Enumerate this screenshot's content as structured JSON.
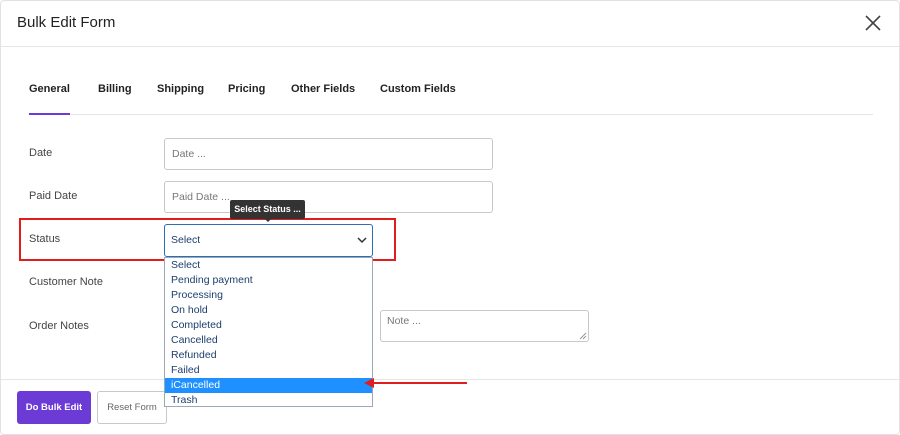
{
  "modal": {
    "title": "Bulk Edit Form"
  },
  "tabs": [
    {
      "label": "General"
    },
    {
      "label": "Billing"
    },
    {
      "label": "Shipping"
    },
    {
      "label": "Pricing"
    },
    {
      "label": "Other Fields"
    },
    {
      "label": "Custom Fields"
    }
  ],
  "form": {
    "date": {
      "label": "Date",
      "placeholder": "Date ..."
    },
    "paid_date": {
      "label": "Paid Date",
      "placeholder": "Paid Date ..."
    },
    "status": {
      "label": "Status",
      "tooltip": "Select Status ...",
      "value": "Select",
      "options": [
        "Select",
        "Pending payment",
        "Processing",
        "On hold",
        "Completed",
        "Cancelled",
        "Refunded",
        "Failed",
        "iCancelled",
        "Trash"
      ],
      "highlighted_option": "iCancelled"
    },
    "customer_note": {
      "label": "Customer Note"
    },
    "order_notes": {
      "label": "Order Notes",
      "placeholder": "Note ..."
    }
  },
  "footer": {
    "primary_label": "Do Bulk Edit",
    "secondary_label": "Reset Form"
  },
  "colors": {
    "accent": "#6c3bd5",
    "highlight_outline": "#e01e1e",
    "selected_option": "#1e90ff",
    "select_border": "#2e6db4"
  },
  "icons": {
    "close": "close-icon",
    "chevron": "chevron-down-icon",
    "annotation_arrow": "arrow-left-icon"
  }
}
